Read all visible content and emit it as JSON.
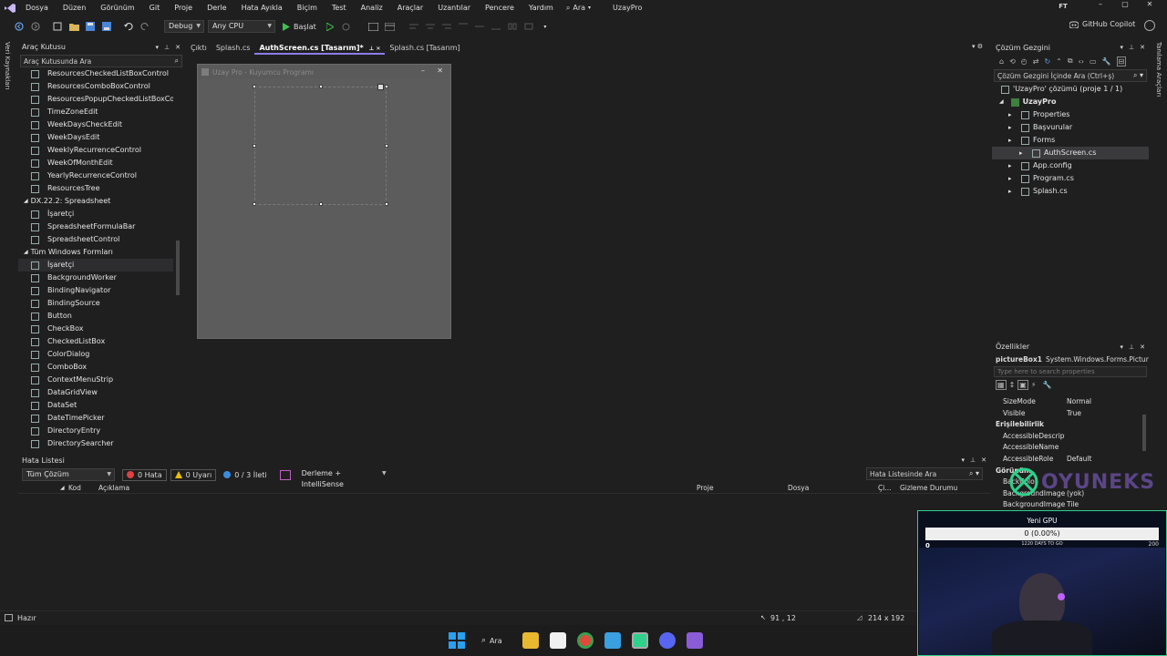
{
  "menubar": {
    "items": [
      "Dosya",
      "Düzen",
      "Görünüm",
      "Git",
      "Proje",
      "Derle",
      "Hata Ayıkla",
      "Biçim",
      "Test",
      "Analiz",
      "Araçlar",
      "Uzantılar",
      "Pencere",
      "Yardım"
    ],
    "search_label": "Ara",
    "solution_name": "UzayPro",
    "user_initials": "FT",
    "copilot_label": "GitHub Copilot"
  },
  "toolbar": {
    "config": "Debug",
    "platform": "Any CPU",
    "start_label": "Başlat"
  },
  "left_rail": {
    "label": "Veri Kaynakları"
  },
  "right_rail": {
    "label": "Tanılama Araçları"
  },
  "toolbox": {
    "title": "Araç Kutusu",
    "search_placeholder": "Araç Kutusunda Ara",
    "items": [
      {
        "label": "ResourcesCheckedListBoxControl",
        "section": false
      },
      {
        "label": "ResourcesComboBoxControl",
        "section": false
      },
      {
        "label": "ResourcesPopupCheckedListBoxCo...",
        "section": false
      },
      {
        "label": "TimeZoneEdit",
        "section": false
      },
      {
        "label": "WeekDaysCheckEdit",
        "section": false
      },
      {
        "label": "WeekDaysEdit",
        "section": false
      },
      {
        "label": "WeeklyRecurrenceControl",
        "section": false
      },
      {
        "label": "WeekOfMonthEdit",
        "section": false
      },
      {
        "label": "YearlyRecurrenceControl",
        "section": false
      },
      {
        "label": "ResourcesTree",
        "section": false
      },
      {
        "label": "DX.22.2: Spreadsheet",
        "section": true
      },
      {
        "label": "İşaretçi",
        "section": false
      },
      {
        "label": "SpreadsheetFormulaBar",
        "section": false
      },
      {
        "label": "SpreadsheetControl",
        "section": false
      },
      {
        "label": "Tüm Windows Formları",
        "section": true
      },
      {
        "label": "İşaretçi",
        "section": false,
        "selected": true
      },
      {
        "label": "BackgroundWorker",
        "section": false
      },
      {
        "label": "BindingNavigator",
        "section": false
      },
      {
        "label": "BindingSource",
        "section": false
      },
      {
        "label": "Button",
        "section": false
      },
      {
        "label": "CheckBox",
        "section": false
      },
      {
        "label": "CheckedListBox",
        "section": false
      },
      {
        "label": "ColorDialog",
        "section": false
      },
      {
        "label": "ComboBox",
        "section": false
      },
      {
        "label": "ContextMenuStrip",
        "section": false
      },
      {
        "label": "DataGridView",
        "section": false
      },
      {
        "label": "DataSet",
        "section": false
      },
      {
        "label": "DateTimePicker",
        "section": false
      },
      {
        "label": "DirectoryEntry",
        "section": false
      },
      {
        "label": "DirectorySearcher",
        "section": false
      }
    ]
  },
  "editor_tabs": [
    {
      "label": "Çıktı",
      "active": false
    },
    {
      "label": "Splash.cs",
      "active": false
    },
    {
      "label": "AuthScreen.cs [Tasarım]*",
      "active": true
    },
    {
      "label": "Splash.cs [Tasarım]",
      "active": false
    }
  ],
  "designer": {
    "form_title": "Uzay Pro - Kuyumcu Programı"
  },
  "solution_explorer": {
    "title": "Çözüm Gezgini",
    "search_placeholder": "Çözüm Gezgini İçinde Ara (Ctrl+ş)",
    "solution_label": "'UzayPro' çözümü (proje 1 / 1)",
    "project": "UzayPro",
    "nodes": [
      {
        "label": "Properties",
        "level": 2
      },
      {
        "label": "Başvurular",
        "level": 2
      },
      {
        "label": "Forms",
        "level": 2
      },
      {
        "label": "AuthScreen.cs",
        "level": 3,
        "selected": true
      },
      {
        "label": "App.config",
        "level": 2
      },
      {
        "label": "Program.cs",
        "level": 2
      },
      {
        "label": "Splash.cs",
        "level": 2
      }
    ]
  },
  "properties": {
    "title": "Özellikler",
    "object_name": "pictureBox1",
    "object_type": "System.Windows.Forms.Pictur",
    "search_placeholder": "Type here to search properties",
    "rows": [
      {
        "k": "SizeMode",
        "v": "Normal",
        "section": false
      },
      {
        "k": "Visible",
        "v": "True",
        "section": false
      },
      {
        "k": "Erişilebilirlik",
        "v": "",
        "section": true
      },
      {
        "k": "AccessibleDescripti",
        "v": "",
        "section": false
      },
      {
        "k": "AccessibleName",
        "v": "",
        "section": false
      },
      {
        "k": "AccessibleRole",
        "v": "Default",
        "section": false
      },
      {
        "k": "Görünüm",
        "v": "",
        "section": true
      },
      {
        "k": "BackColor",
        "v": "",
        "section": false
      },
      {
        "k": "BackgroundImage",
        "v": "(yok)",
        "section": false
      },
      {
        "k": "BackgroundImageL",
        "v": "Tile",
        "section": false
      }
    ]
  },
  "error_list": {
    "title": "Hata Listesi",
    "scope": "Tüm Çözüm",
    "errors": "0 Hata",
    "warnings": "0 Uyarı",
    "messages": "0 / 3 İleti",
    "build_filter": "Derleme + IntelliSense",
    "search_placeholder": "Hata Listesinde Ara",
    "columns": [
      "Kod",
      "Açıklama",
      "Proje",
      "Dosya",
      "Çi...",
      "Gizleme Durumu"
    ]
  },
  "statusbar": {
    "status": "Hazır",
    "position": "91 , 12",
    "size": "214 x 192"
  },
  "taskbar": {
    "search_label": "Ara"
  },
  "overlay": {
    "watermark": "OYUNEKS",
    "goal_title": "Yeni GPU",
    "goal_amount": "0 (0.00%)",
    "goal_fraction": 0,
    "goal_min": "0",
    "goal_days": "1220 DAYS TO GO",
    "goal_max": "200"
  },
  "colors": {
    "accent": "#8a7cf0",
    "error_red": "#e04040",
    "warning_yellow": "#e8c000",
    "info_blue": "#3b8de0",
    "run_green": "#3fbf4f"
  }
}
